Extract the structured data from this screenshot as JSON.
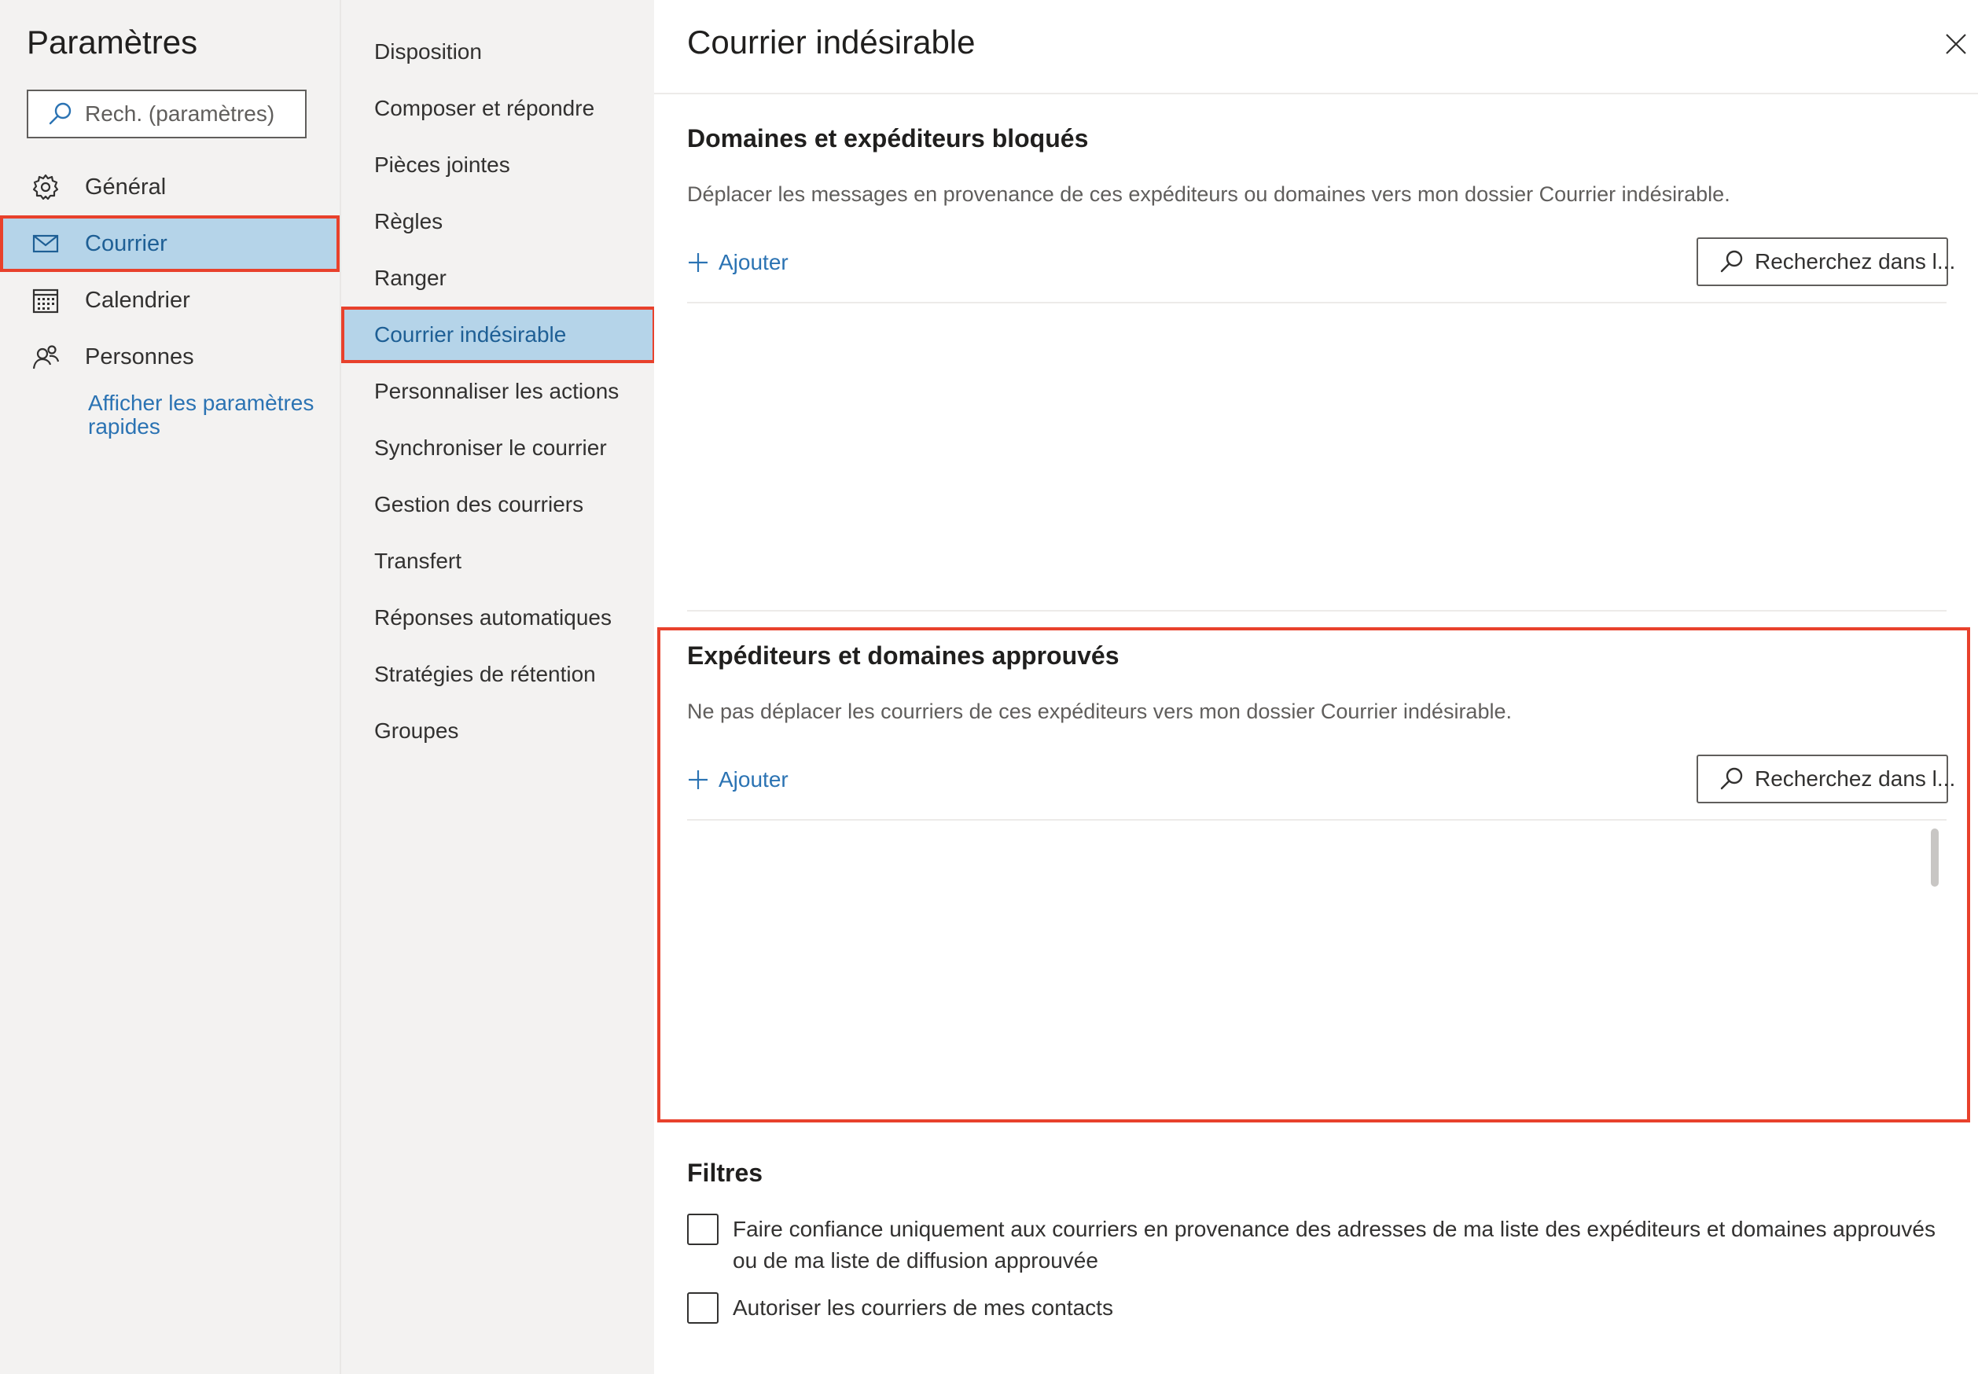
{
  "sidebar": {
    "title": "Paramètres",
    "search_placeholder": "Rech. (paramètres)",
    "items": [
      {
        "label": "Général",
        "icon": "gear-icon"
      },
      {
        "label": "Courrier",
        "icon": "mail-icon",
        "selected": true
      },
      {
        "label": "Calendrier",
        "icon": "calendar-icon"
      },
      {
        "label": "Personnes",
        "icon": "people-icon"
      }
    ],
    "quick_settings_link": "Afficher les paramètres rapides"
  },
  "subnav": {
    "items": [
      {
        "label": "Disposition"
      },
      {
        "label": "Composer et répondre"
      },
      {
        "label": "Pièces jointes"
      },
      {
        "label": "Règles"
      },
      {
        "label": "Ranger"
      },
      {
        "label": "Courrier indésirable",
        "selected": true
      },
      {
        "label": "Personnaliser les actions"
      },
      {
        "label": "Synchroniser le courrier"
      },
      {
        "label": "Gestion des courriers"
      },
      {
        "label": "Transfert"
      },
      {
        "label": "Réponses automatiques"
      },
      {
        "label": "Stratégies de rétention"
      },
      {
        "label": "Groupes"
      }
    ]
  },
  "panel": {
    "title": "Courrier indésirable",
    "blocked": {
      "title": "Domaines et expéditeurs bloqués",
      "description": "Déplacer les messages en provenance de ces expéditeurs ou domaines vers mon dossier Courrier indésirable.",
      "add_label": "Ajouter",
      "search_placeholder": "Recherchez dans l..."
    },
    "safe": {
      "title": "Expéditeurs et domaines approuvés",
      "description": "Ne pas déplacer les courriers de ces expéditeurs vers mon dossier Courrier indésirable.",
      "add_label": "Ajouter",
      "search_placeholder": "Recherchez dans l..."
    },
    "filters": {
      "title": "Filtres",
      "options": [
        {
          "label": "Faire confiance uniquement aux courriers en provenance des adresses de ma liste des expéditeurs et domaines approuvés ou de ma liste de diffusion approuvée",
          "checked": false
        },
        {
          "label": "Autoriser les courriers de mes contacts",
          "checked": false
        }
      ]
    }
  },
  "colors": {
    "accent": "#2b73b3",
    "selected_bg": "#b5d4e9",
    "highlight_border": "#e8412c",
    "nav_bg": "#f3f2f1"
  }
}
